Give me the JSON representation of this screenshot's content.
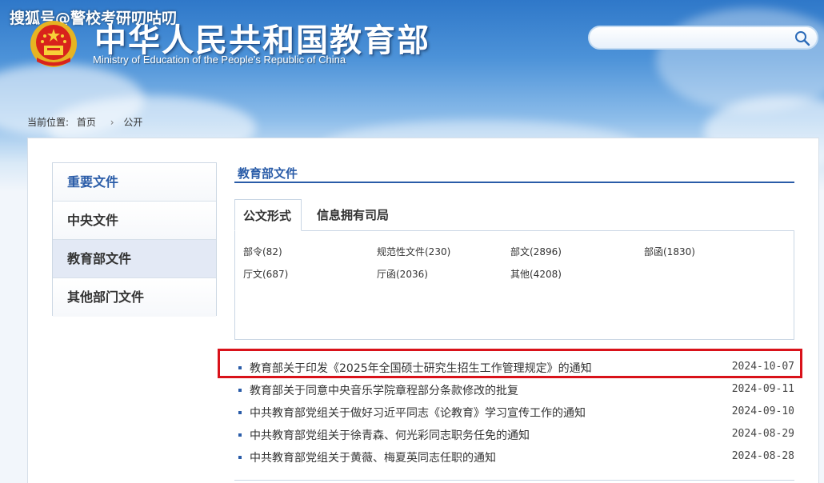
{
  "watermark": "搜狐号@警校考研叨咕叨",
  "header": {
    "title": "中华人民共和国教育部",
    "subtitle": "Ministry of Education of the People's Republic of China",
    "search_placeholder": ""
  },
  "breadcrumb": {
    "label": "当前位置:",
    "home": "首页",
    "current": "公开"
  },
  "sidebar": {
    "items": [
      {
        "label": "重要文件"
      },
      {
        "label": "中央文件"
      },
      {
        "label": "教育部文件"
      },
      {
        "label": "其他部门文件"
      }
    ]
  },
  "main": {
    "section_title": "教育部文件",
    "tabs": [
      {
        "label": "公文形式"
      },
      {
        "label": "信息拥有司局"
      }
    ],
    "filters": [
      {
        "label": "部令(82)"
      },
      {
        "label": "规范性文件(230)"
      },
      {
        "label": "部文(2896)"
      },
      {
        "label": "部函(1830)"
      },
      {
        "label": "厅文(687)"
      },
      {
        "label": "厅函(2036)"
      },
      {
        "label": "其他(4208)"
      }
    ],
    "documents": [
      {
        "title": "教育部关于印发《2025年全国硕士研究生招生工作管理规定》的通知",
        "date": "2024-10-07"
      },
      {
        "title": "教育部关于同意中央音乐学院章程部分条款修改的批复",
        "date": "2024-09-11"
      },
      {
        "title": "中共教育部党组关于做好习近平同志《论教育》学习宣传工作的通知",
        "date": "2024-09-10"
      },
      {
        "title": "中共教育部党组关于徐青森、何光彩同志职务任免的通知",
        "date": "2024-08-29"
      },
      {
        "title": "中共教育部党组关于黄薇、梅夏英同志任职的通知",
        "date": "2024-08-28"
      }
    ]
  },
  "colors": {
    "accent": "#2a5ca8",
    "highlight": "#d9121a"
  }
}
